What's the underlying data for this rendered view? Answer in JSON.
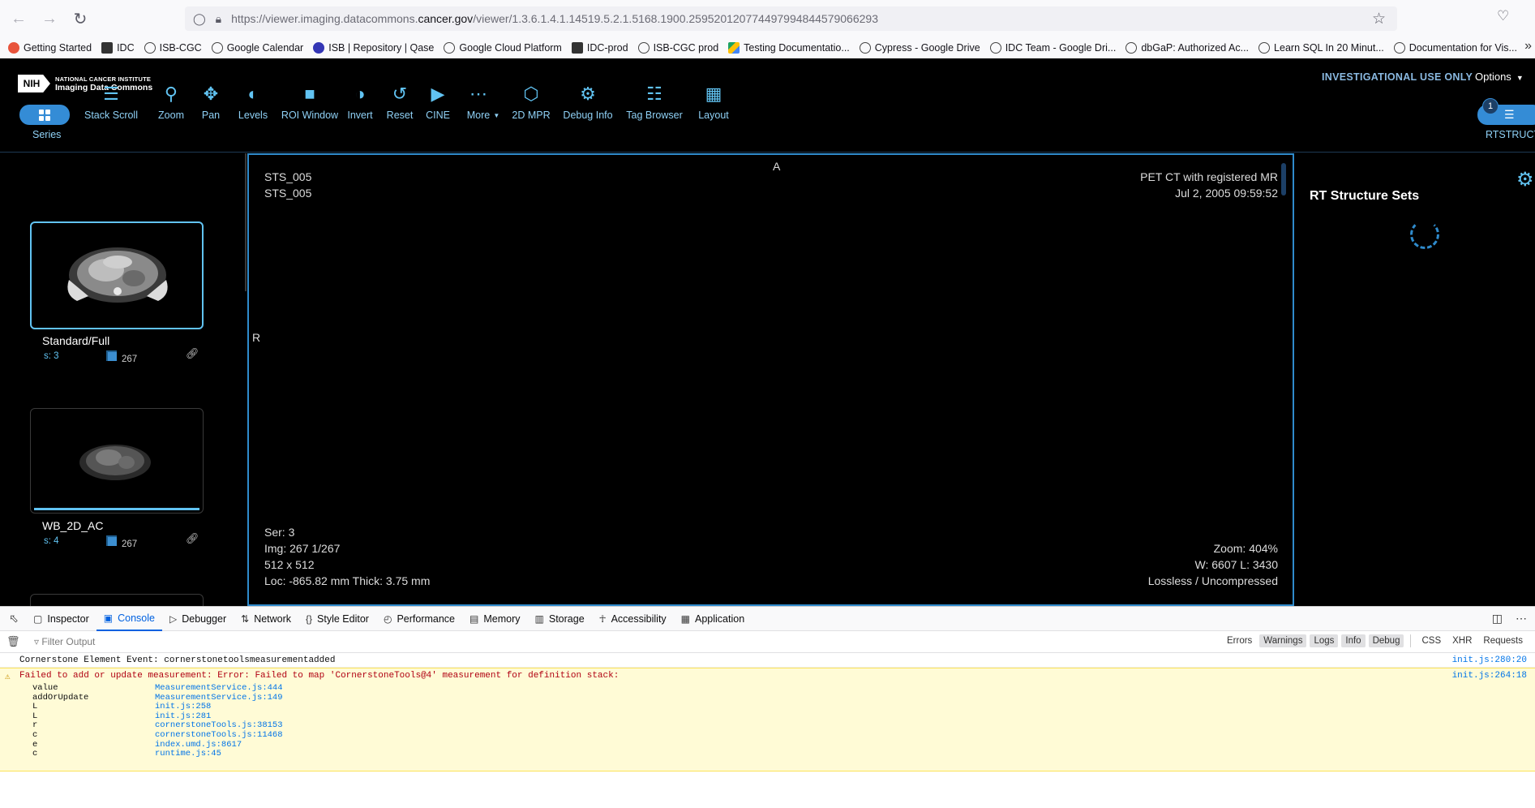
{
  "browser": {
    "url_prefix": "https://viewer.imaging.datacommons.",
    "url_host": "cancer.gov",
    "url_path": "/viewer/1.3.6.1.4.1.14519.5.2.1.5168.1900.259520120774497994844579066293",
    "bookmarks": [
      {
        "label": "Getting Started",
        "icon": "firefox-icon"
      },
      {
        "label": "IDC",
        "icon": "idc-icon"
      },
      {
        "label": "ISB-CGC",
        "icon": "globe-icon"
      },
      {
        "label": "Google Calendar",
        "icon": "globe-icon"
      },
      {
        "label": "ISB | Repository | Qase",
        "icon": "qase-icon"
      },
      {
        "label": "Google Cloud Platform",
        "icon": "globe-icon"
      },
      {
        "label": "IDC-prod",
        "icon": "idc-icon"
      },
      {
        "label": "ISB-CGC prod",
        "icon": "globe-icon"
      },
      {
        "label": "Testing Documentatio...",
        "icon": "google-drive-icon"
      },
      {
        "label": "Cypress - Google Drive",
        "icon": "globe-icon"
      },
      {
        "label": "IDC Team - Google Dri...",
        "icon": "globe-icon"
      },
      {
        "label": "dbGaP: Authorized Ac...",
        "icon": "globe-icon"
      },
      {
        "label": "Learn SQL In 20 Minut...",
        "icon": "globe-icon"
      },
      {
        "label": "Documentation for Vis...",
        "icon": "globe-icon"
      }
    ]
  },
  "header": {
    "logo_line1": "NATIONAL CANCER INSTITUTE",
    "logo_line2": "Imaging Data Commons",
    "nih": "NIH",
    "investigational": "INVESTIGATIONAL USE ONLY",
    "options": "Options",
    "series_label": "Series",
    "tools": [
      {
        "label": "Stack Scroll",
        "icon": "stack-scroll-icon"
      },
      {
        "label": "Zoom",
        "icon": "zoom-icon"
      },
      {
        "label": "Pan",
        "icon": "pan-icon"
      },
      {
        "label": "Levels",
        "icon": "levels-icon"
      },
      {
        "label": "ROI Window",
        "icon": "roi-window-icon"
      },
      {
        "label": "Invert",
        "icon": "invert-icon"
      },
      {
        "label": "Reset",
        "icon": "reset-icon"
      },
      {
        "label": "CINE",
        "icon": "cine-icon"
      },
      {
        "label": "More",
        "icon": "more-icon"
      },
      {
        "label": "2D MPR",
        "icon": "mpr-icon"
      },
      {
        "label": "Debug Info",
        "icon": "debug-icon"
      },
      {
        "label": "Tag Browser",
        "icon": "tag-browser-icon"
      },
      {
        "label": "Layout",
        "icon": "layout-icon"
      }
    ],
    "rtstruct_badge": "1",
    "rtstruct_label": "RTSTRUCT"
  },
  "thumbnails": [
    {
      "title": "Standard/Full",
      "series": "s: 3",
      "count": "267"
    },
    {
      "title": "WB_2D_AC",
      "series": "s: 4",
      "count": "267"
    }
  ],
  "viewport": {
    "orient_top": "A",
    "orient_left": "R",
    "patient_name": "STS_005",
    "patient_id": "STS_005",
    "study_desc": "PET CT with registered MR",
    "study_date": "Jul 2, 2005 09:59:52",
    "series": "Ser: 3",
    "image": "Img: 267 1/267",
    "dims": "512 x 512",
    "loc": "Loc: -865.82 mm Thick: 3.75 mm",
    "zoom": "Zoom: 404%",
    "wl": "W: 6607 L: 3430",
    "compression": "Lossless / Uncompressed"
  },
  "right_panel": {
    "title": "RT Structure Sets"
  },
  "devtools": {
    "tabs": [
      {
        "label": "Inspector",
        "icon": "inspector-icon"
      },
      {
        "label": "Console",
        "icon": "console-icon",
        "active": true
      },
      {
        "label": "Debugger",
        "icon": "debugger-icon"
      },
      {
        "label": "Network",
        "icon": "network-icon"
      },
      {
        "label": "Style Editor",
        "icon": "style-editor-icon"
      },
      {
        "label": "Performance",
        "icon": "performance-icon"
      },
      {
        "label": "Memory",
        "icon": "memory-icon"
      },
      {
        "label": "Storage",
        "icon": "storage-icon"
      },
      {
        "label": "Accessibility",
        "icon": "accessibility-icon"
      },
      {
        "label": "Application",
        "icon": "application-icon"
      }
    ],
    "filter_placeholder": "Filter Output",
    "levels": [
      "Errors",
      "Warnings",
      "Logs",
      "Info",
      "Debug"
    ],
    "extra_levels": [
      "CSS",
      "XHR",
      "Requests"
    ],
    "log_line": "Cornerstone Element Event: cornerstonetoolsmeasurementadded",
    "log_src": "init.js:280:20",
    "warn_text": "Failed to add or update measurement: Error: Failed to map 'CornerstoneTools@4' measurement for definition stack:",
    "warn_src": "init.js:264:18",
    "stack": [
      {
        "fn": "value",
        "loc": "MeasurementService.js:444"
      },
      {
        "fn": "addOrUpdate",
        "loc": "MeasurementService.js:149"
      },
      {
        "fn": "L",
        "loc": "init.js:258"
      },
      {
        "fn": "L",
        "loc": "init.js:281"
      },
      {
        "fn": "r",
        "loc": "cornerstoneTools.js:38153"
      },
      {
        "fn": "c",
        "loc": "cornerstoneTools.js:11468"
      },
      {
        "fn": "e",
        "loc": "index.umd.js:8617"
      },
      {
        "fn": "c",
        "loc": "runtime.js:45"
      }
    ],
    "prompt": "»"
  },
  "colors": {
    "accent": "#61c3f2",
    "button_blue": "#348cd6",
    "viewport_border": "#2f8bcc",
    "warning_bg": "#fffbd6"
  }
}
